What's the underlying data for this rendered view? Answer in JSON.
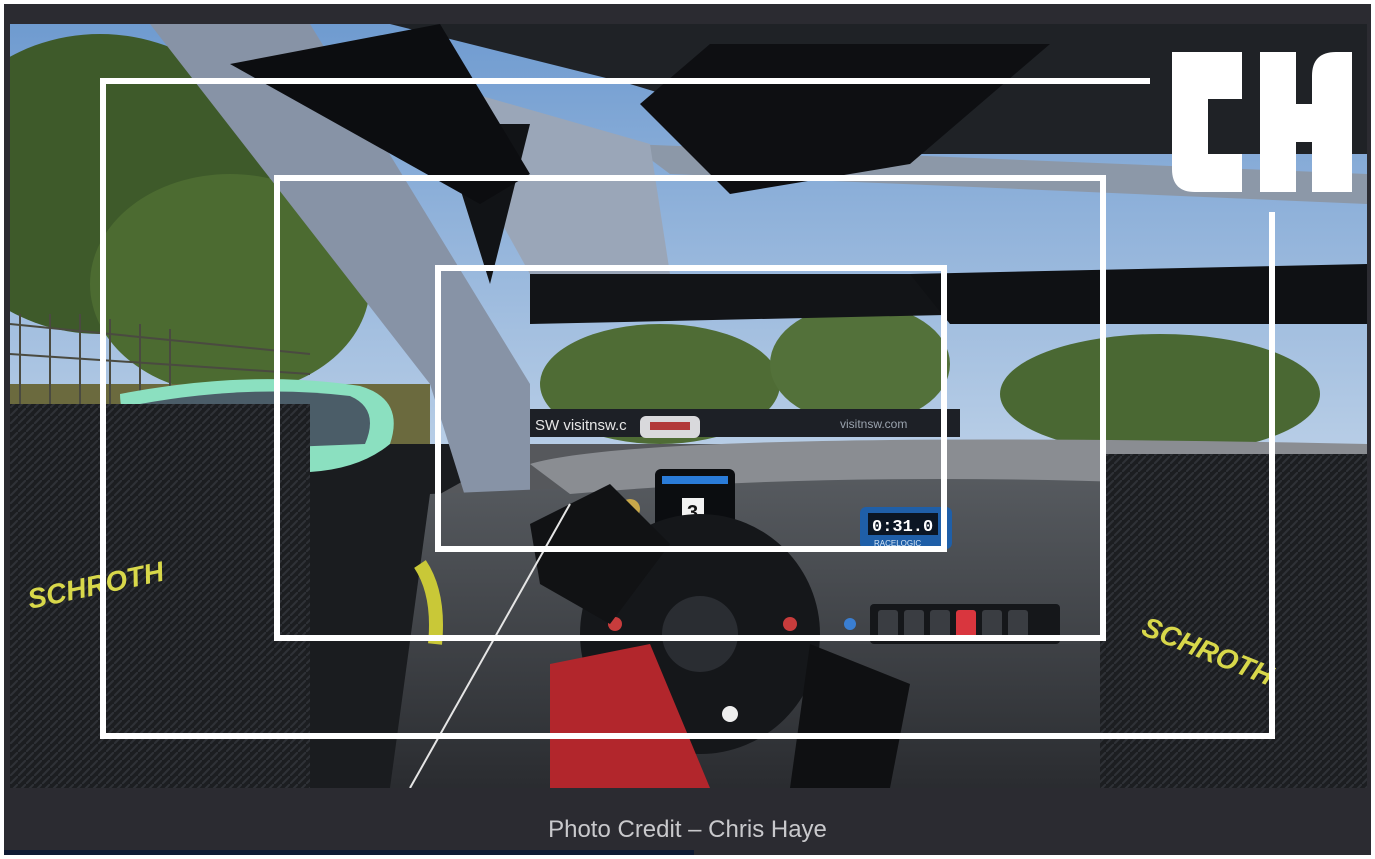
{
  "scene": {
    "description_icon": "racing-cockpit-screenshot",
    "track_banner_left": "SW  visitnsw.c",
    "track_banner_right": "visitnsw.com",
    "dash_gear": "3",
    "timer": {
      "value": "0:31.0",
      "brand": "RACELOGIC"
    },
    "harness_text": "SCHROTH",
    "logo_text": "CH"
  },
  "overlay": {
    "colors": {
      "frames": "#ffffff"
    }
  },
  "caption": {
    "text": "Photo Credit – Chris Haye"
  }
}
